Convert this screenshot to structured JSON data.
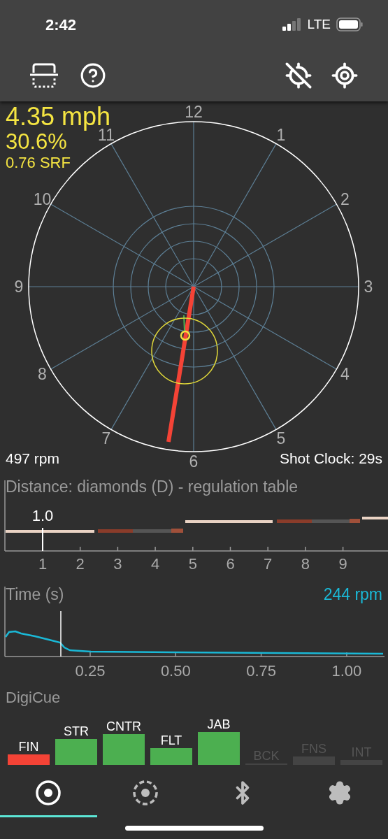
{
  "status_bar": {
    "time": "2:42",
    "network": "LTE"
  },
  "readout": {
    "speed": "4.35 mph",
    "percent": "30.6%",
    "srf": "0.76 SRF"
  },
  "dial": {
    "clock_labels": [
      "12",
      "1",
      "2",
      "3",
      "4",
      "5",
      "6",
      "7",
      "8",
      "9",
      "10",
      "11"
    ]
  },
  "rpm": "497 rpm",
  "shot_clock": "Shot Clock: 29s",
  "distance_chart": {
    "title": "Distance: diamonds (D) - regulation table",
    "marker_label": "1.0",
    "ticks": [
      "1",
      "2",
      "3",
      "4",
      "5",
      "6",
      "7",
      "8",
      "9"
    ]
  },
  "time_chart": {
    "title": "Time (s)",
    "reading": "244 rpm",
    "ticks": [
      "0.25",
      "0.50",
      "0.75",
      "1.00"
    ]
  },
  "digicue": {
    "title": "DigiCue",
    "metrics": [
      {
        "label": "FIN",
        "enabled": true,
        "color": "#f44336"
      },
      {
        "label": "STR",
        "enabled": true,
        "color": "#4caf50"
      },
      {
        "label": "CNTR",
        "enabled": true,
        "color": "#4caf50"
      },
      {
        "label": "FLT",
        "enabled": true,
        "color": "#4caf50"
      },
      {
        "label": "JAB",
        "enabled": true,
        "color": "#4caf50"
      },
      {
        "label": "BCK",
        "enabled": false,
        "color": "#444444"
      },
      {
        "label": "FNS",
        "enabled": false,
        "color": "#444444"
      },
      {
        "label": "INT",
        "enabled": false,
        "color": "#444444"
      }
    ]
  },
  "tabs": [
    {
      "kind": "target",
      "selected": true
    },
    {
      "kind": "dashed-target",
      "selected": false
    },
    {
      "kind": "bluetooth",
      "selected": false
    },
    {
      "kind": "settings",
      "selected": false
    }
  ]
}
